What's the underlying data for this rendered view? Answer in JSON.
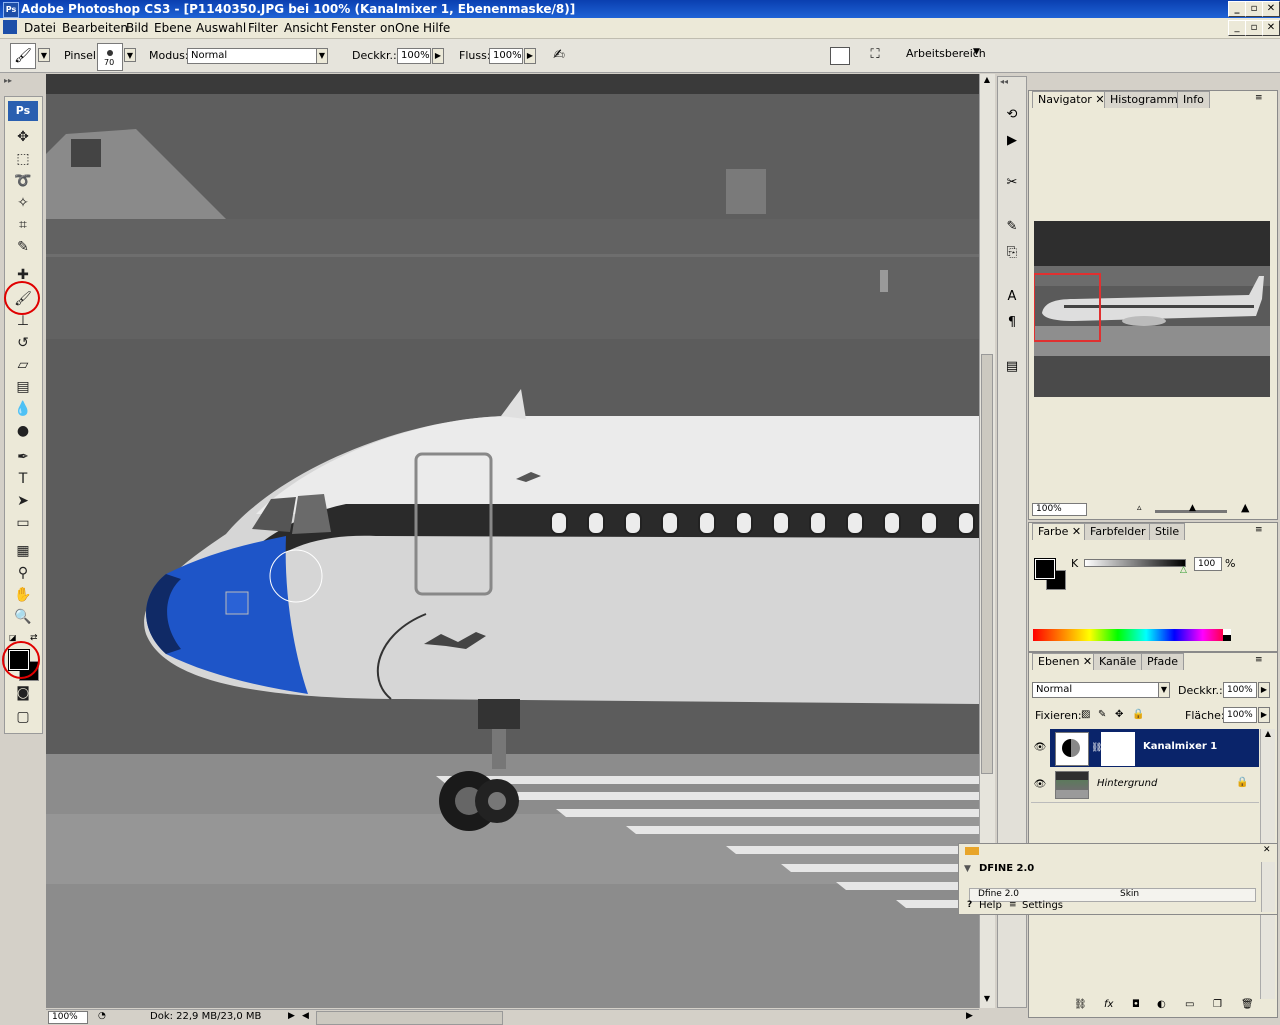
{
  "window": {
    "title": "Adobe Photoshop CS3 - [P1140350.JPG bei 100% (Kanalmixer 1, Ebenenmaske/8)]",
    "app_icon": "Ps"
  },
  "menu": [
    "Datei",
    "Bearbeiten",
    "Bild",
    "Ebene",
    "Auswahl",
    "Filter",
    "Ansicht",
    "Fenster",
    "onOne",
    "Hilfe"
  ],
  "options": {
    "brush_label": "Pinsel:",
    "brush_size": "70",
    "mode_label": "Modus:",
    "mode_value": "Normal",
    "opacity_label": "Deckkr.:",
    "opacity_value": "100%",
    "flow_label": "Fluss:",
    "flow_value": "100%",
    "workspace_label": "Arbeitsbereich"
  },
  "toolbox": {
    "logo": "Ps"
  },
  "navigator": {
    "tabs": [
      "Navigator",
      "Histogramm",
      "Info"
    ],
    "zoom": "100%"
  },
  "color_panel": {
    "tabs": [
      "Farbe",
      "Farbfelder",
      "Stile"
    ],
    "channel": "K",
    "value": "100",
    "unit": "%"
  },
  "layers_panel": {
    "tabs": [
      "Ebenen",
      "Kanäle",
      "Pfade"
    ],
    "blend_mode": "Normal",
    "opacity_label": "Deckkr.:",
    "opacity": "100%",
    "lock_label": "Fixieren:",
    "fill_label": "Fläche:",
    "fill": "100%",
    "layers": [
      {
        "name": "Kanalmixer 1",
        "selected": true
      },
      {
        "name": "Hintergrund",
        "locked": true
      }
    ]
  },
  "dfine": {
    "title": "DFINE 2.0",
    "row1_left": "Dfine 2.0",
    "row1_right": "Skin",
    "help": "Help",
    "settings": "Settings"
  },
  "status": {
    "zoom": "100%",
    "doc": "Dok: 22,9 MB/23,0 MB"
  },
  "colors": {
    "accent": "#0a246a",
    "title_bar": "#0a3fb0",
    "highlight_circle": "#e00000",
    "nose_blue": "#1e55c8"
  }
}
